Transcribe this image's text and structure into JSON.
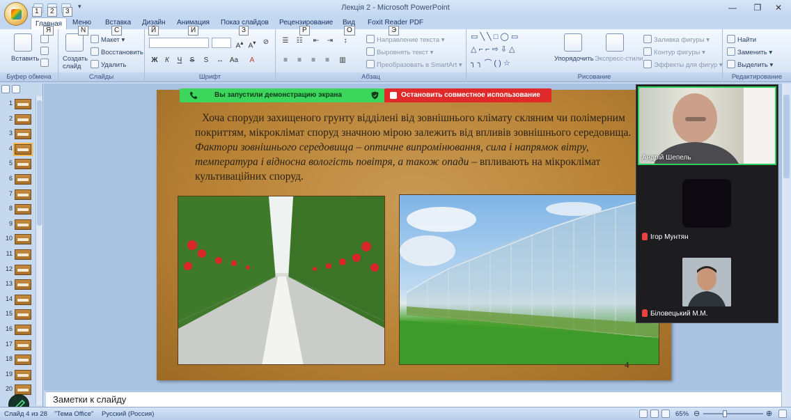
{
  "window": {
    "title": "Лекція 2 - Microsoft PowerPoint",
    "min_glyph": "—",
    "max_glyph": "❐",
    "close_glyph": "✕"
  },
  "keytips": {
    "qat": [
      "1",
      "2",
      "3"
    ],
    "tabs": [
      "Я",
      "N",
      "С",
      "Й",
      "И",
      "З",
      "Р",
      "О",
      "Э"
    ]
  },
  "tabs": [
    "Главная",
    "Меню",
    "Вставка",
    "Дизайн",
    "Анимация",
    "Показ слайдов",
    "Рецензирование",
    "Вид",
    "Foxit Reader PDF"
  ],
  "ribbon": {
    "clipboard": {
      "label": "Буфер обмена",
      "paste": "Вставить"
    },
    "slides": {
      "label": "Слайды",
      "new_slide": "Создать слайд",
      "layout": "Макет",
      "reset": "Восстановить",
      "delete": "Удалить"
    },
    "font": {
      "label": "Шрифт"
    },
    "paragraph": {
      "label": "Абзац",
      "text_direction": "Направление текста",
      "align_text": "Выровнять текст",
      "smartart": "Преобразовать в SmartArt"
    },
    "drawing": {
      "label": "Рисование",
      "arrange": "Упорядочить",
      "quick_styles": "Экспресс-стили",
      "fill": "Заливка фигуры",
      "outline": "Контур фигуры",
      "effects": "Эффекты для фигур"
    },
    "editing": {
      "label": "Редактирование",
      "find": "Найти",
      "replace": "Заменить",
      "select": "Выделить"
    }
  },
  "thumbnails": {
    "numbers": [
      "1",
      "2",
      "3",
      "4",
      "5",
      "6",
      "7",
      "8",
      "9",
      "10",
      "11",
      "12",
      "13",
      "14",
      "15",
      "16",
      "17",
      "18",
      "19",
      "20"
    ],
    "selected_index": 3
  },
  "share": {
    "screen_share": "Вы запустили демонстрацию экрана",
    "stop_share": "Остановить совместное использование",
    "colors": {
      "share_bg": "#3bd65b",
      "stop_bg": "#e02a2a"
    }
  },
  "slide": {
    "text_normal_1": "Хоча споруди захищеного грунту відділені від зовнішнього клімату скляним чи полімерним покриттям, мікроклімат споруд значною мірою залежить від впливів зовнішнього середовища. ",
    "text_italic": "Фактори зовнішнього середовища – оптичне випромінювання, сила і напрямок вітру, температура і відносна вологість повітря, а також опади",
    "text_normal_2": " – впливають на мікроклімат культиваційних споруд.",
    "number": "4"
  },
  "participants": [
    {
      "name": "Андрій Шепель",
      "muted": false
    },
    {
      "name": "Ігор Мунтян",
      "muted": true
    },
    {
      "name": "Біловецький М.М.",
      "muted": true
    }
  ],
  "notes": {
    "placeholder": "Заметки к слайду"
  },
  "status": {
    "slide_of": "Слайд 4 из 28",
    "theme": "\"Тема Office\"",
    "language": "Русский (Россия)",
    "zoom": "65%"
  }
}
